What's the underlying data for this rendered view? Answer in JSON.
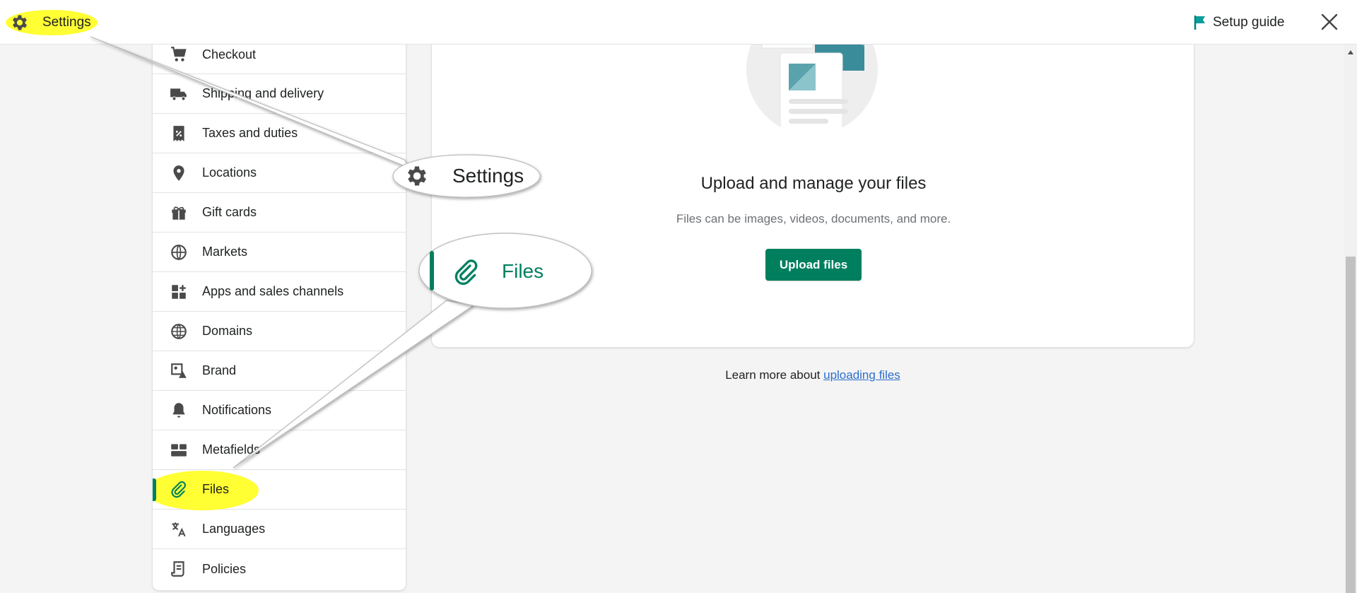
{
  "header": {
    "title": "Settings",
    "setup_guide": "Setup guide"
  },
  "sidebar": {
    "items": [
      {
        "label": "Checkout",
        "icon": "cart-icon"
      },
      {
        "label": "Shipping and delivery",
        "icon": "truck-icon"
      },
      {
        "label": "Taxes and duties",
        "icon": "receipt-percent-icon"
      },
      {
        "label": "Locations",
        "icon": "location-pin-icon"
      },
      {
        "label": "Gift cards",
        "icon": "gift-icon"
      },
      {
        "label": "Markets",
        "icon": "globe-markets-icon"
      },
      {
        "label": "Apps and sales channels",
        "icon": "apps-icon"
      },
      {
        "label": "Domains",
        "icon": "globe-icon"
      },
      {
        "label": "Brand",
        "icon": "brand-icon"
      },
      {
        "label": "Notifications",
        "icon": "bell-icon"
      },
      {
        "label": "Metafields",
        "icon": "metafields-icon"
      },
      {
        "label": "Files",
        "icon": "paperclip-icon",
        "active": true
      },
      {
        "label": "Languages",
        "icon": "translate-icon"
      },
      {
        "label": "Policies",
        "icon": "document-icon"
      }
    ]
  },
  "main": {
    "heading": "Upload and manage your files",
    "subtext": "Files can be images, videos, documents, and more.",
    "upload_button": "Upload files",
    "learn_more_prefix": "Learn more about ",
    "learn_more_link": "uploading files"
  },
  "callouts": {
    "settings_label": "Settings",
    "files_label": "Files"
  },
  "colors": {
    "accent": "#008060",
    "highlight": "#ffff33",
    "link": "#2c6ecb"
  }
}
